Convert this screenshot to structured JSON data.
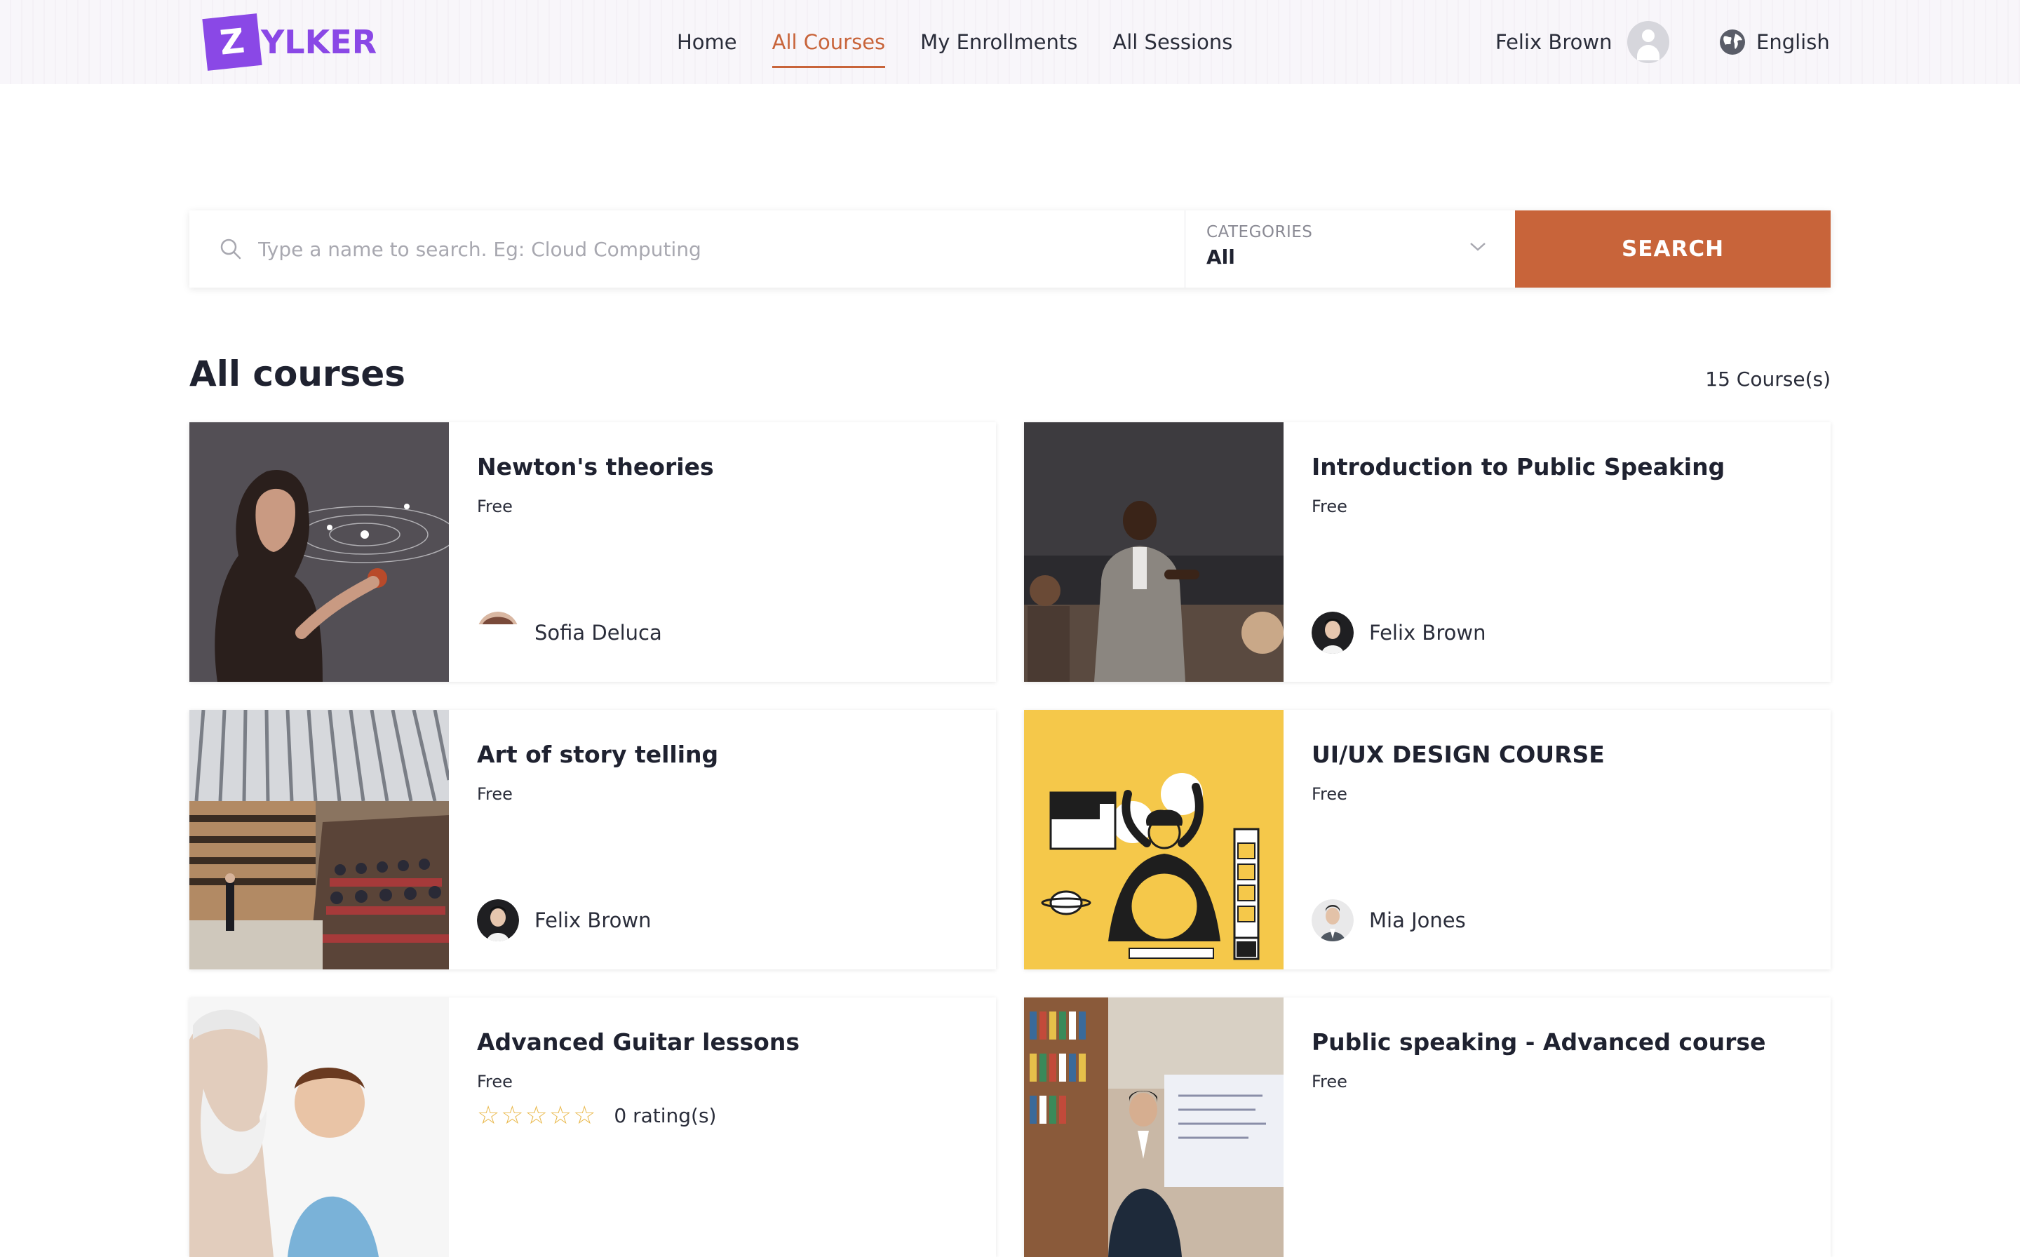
{
  "header": {
    "logo_letter": "Z",
    "logo_text": "YLKER",
    "nav": [
      {
        "label": "Home",
        "active": false
      },
      {
        "label": "All Courses",
        "active": true
      },
      {
        "label": "My Enrollments",
        "active": false
      },
      {
        "label": "All Sessions",
        "active": false
      }
    ],
    "user_name": "Felix Brown",
    "language": "English"
  },
  "search": {
    "placeholder": "Type a name to search. Eg: Cloud Computing",
    "value": "",
    "category_label": "CATEGORIES",
    "category_value": "All",
    "button_label": "SEARCH"
  },
  "courses_section": {
    "title": "All courses",
    "count_text": "15 Course(s)"
  },
  "courses": [
    {
      "title": "Newton's theories",
      "price": "Free",
      "instructor": "Sofia Deluca",
      "thumbnail": "scientist-with-orbits",
      "instructor_avatar": "woman-avatar"
    },
    {
      "title": "Introduction to Public Speaking",
      "price": "Free",
      "instructor": "Felix Brown",
      "thumbnail": "speaker-on-stage",
      "instructor_avatar": "man-avatar"
    },
    {
      "title": "Art of story telling",
      "price": "Free",
      "instructor": "Felix Brown",
      "thumbnail": "auditorium",
      "instructor_avatar": "man-avatar"
    },
    {
      "title": "UI/UX DESIGN COURSE",
      "price": "Free",
      "instructor": "Mia Jones",
      "thumbnail": "design-illustration",
      "instructor_avatar": "man-suit-avatar"
    },
    {
      "title": "Advanced Guitar lessons",
      "price": "Free",
      "rating_stars": 0,
      "rating_text": "0 rating(s)",
      "thumbnail": "grandfather-and-boy"
    },
    {
      "title": "Public speaking - Advanced course",
      "price": "Free",
      "thumbnail": "speaker-in-library"
    }
  ],
  "colors": {
    "accent": "#c8643a",
    "brand": "#8a48e6",
    "design_yellow": "#f5c84a"
  }
}
